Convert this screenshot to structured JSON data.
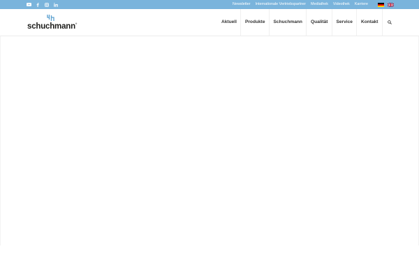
{
  "topbar": {
    "social_icons": [
      "youtube-icon",
      "facebook-icon",
      "instagram-icon",
      "linkedin-icon"
    ],
    "links": [
      "Newsletter",
      "Internationale Vertriebspartner",
      "Mediathek",
      "Videothek",
      "Karriere"
    ],
    "languages": [
      "de-flag-icon",
      "en-flag-icon"
    ],
    "bg_color": "#7ab4dc"
  },
  "header": {
    "logo_text": "schuchmann",
    "nav": [
      "Aktuell",
      "Produkte",
      "Schuchmann",
      "Qualität",
      "Service",
      "Kontakt"
    ],
    "search_icon": "search-icon"
  }
}
